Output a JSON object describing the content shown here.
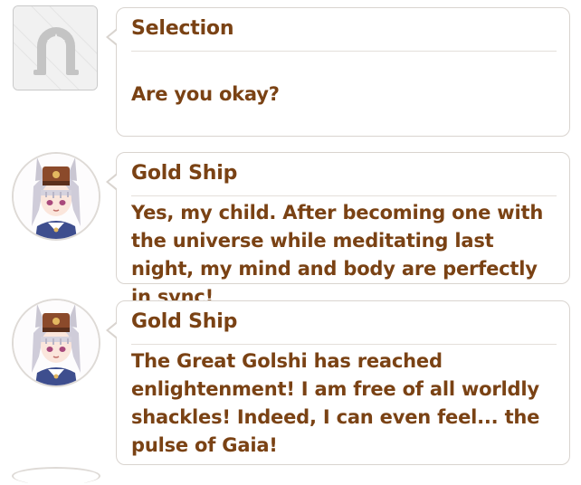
{
  "messages": [
    {
      "speaker": "Selection",
      "text": "Are you okay?",
      "icon": "horseshoe-icon"
    },
    {
      "speaker": "Gold Ship",
      "text": "Yes, my child. After becoming one with the universe while meditating last night, my mind and body are perfectly in sync!",
      "icon": "gold-ship-avatar"
    },
    {
      "speaker": "Gold Ship",
      "text": "The Great Golshi has reached enlightenment! I am free of all worldly shackles! Indeed, I can even feel... the pulse of Gaia!",
      "icon": "gold-ship-avatar"
    }
  ],
  "colors": {
    "text": "#7a4214",
    "bubble_border": "#d9d4cf",
    "hair": "#c9c6d2",
    "cap": "#8b4a2b"
  }
}
